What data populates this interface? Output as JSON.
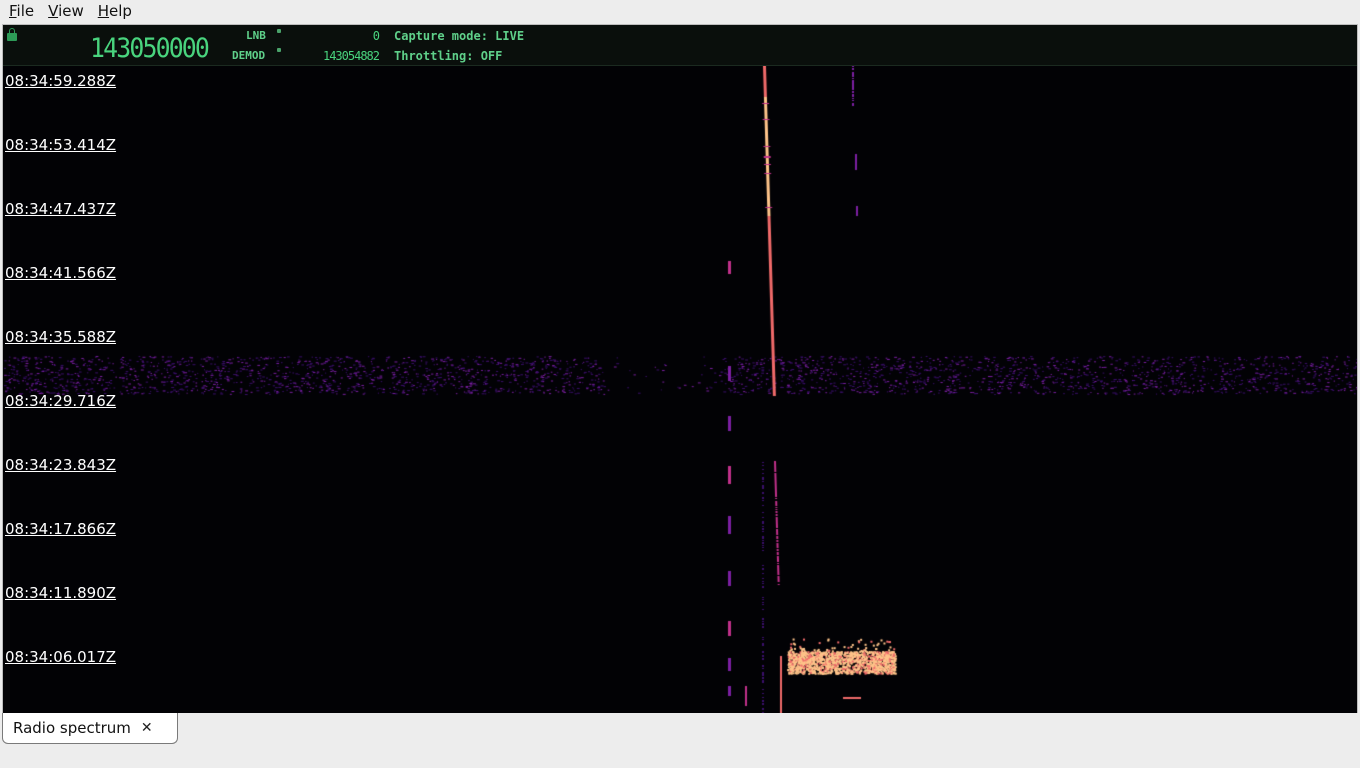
{
  "menubar": {
    "items": [
      {
        "label": "File",
        "mnemonic": "F",
        "rest": "ile"
      },
      {
        "label": "View",
        "mnemonic": "V",
        "rest": "iew"
      },
      {
        "label": "Help",
        "mnemonic": "H",
        "rest": "elp"
      }
    ]
  },
  "status": {
    "main_frequency": "143050000",
    "lnb_label": "LNB",
    "lnb_value": "0",
    "demod_label": "DEMOD",
    "demod_value": "143054882",
    "capture_mode": "Capture mode: LIVE",
    "throttling": "Throttling: OFF",
    "accent_color": "#5fd08a"
  },
  "waterfall": {
    "time_labels": [
      "08:34:59.288Z",
      "08:34:53.414Z",
      "08:34:47.437Z",
      "08:34:41.566Z",
      "08:34:35.588Z",
      "08:34:29.716Z",
      "08:34:23.843Z",
      "08:34:17.866Z",
      "08:34:11.890Z",
      "08:34:06.017Z"
    ],
    "background_color": "#020205",
    "palette": [
      "#3a0f6b",
      "#7b1fa2",
      "#c0308a",
      "#f06a6a",
      "#ffc48a"
    ]
  },
  "tabs": [
    {
      "label": "Radio spectrum",
      "close_icon": "close-icon"
    }
  ]
}
